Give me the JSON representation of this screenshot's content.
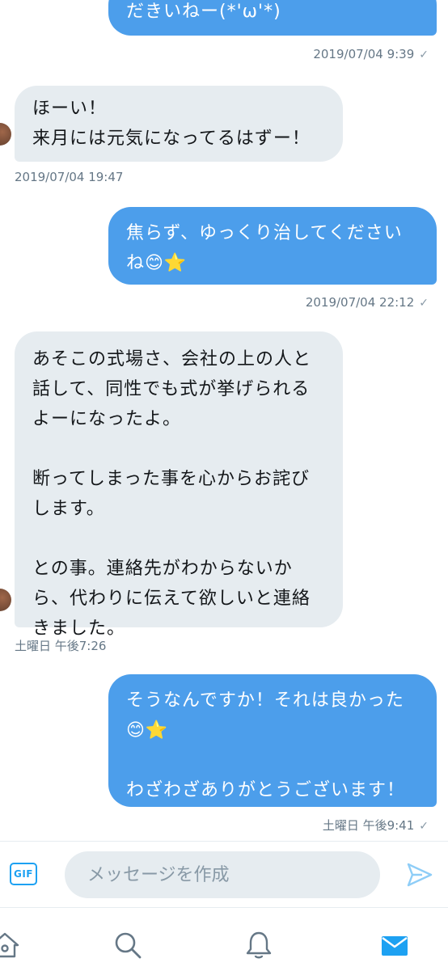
{
  "messages": [
    {
      "direction": "out",
      "text": "だきいねー(*'ω'*)",
      "timestamp": "2019/07/04 9:39",
      "read_mark": "✓"
    },
    {
      "direction": "in",
      "text": "ほーい！\n来月には元気になってるはずー！",
      "timestamp": "2019/07/04 19:47"
    },
    {
      "direction": "out",
      "text": "焦らず、ゆっくり治してくださいね😊⭐",
      "timestamp": "2019/07/04 22:12",
      "read_mark": "✓"
    },
    {
      "direction": "in",
      "text": "あそこの式場さ、会社の上の人と話して、同性でも式が挙げられるよーになったよ。\n\n断ってしまった事を心からお詫びします。\n\nとの事。連絡先がわからないから、代わりに伝えて欲しいと連絡きました。",
      "timestamp": "土曜日 午後7:26"
    },
    {
      "direction": "out",
      "text": "そうなんですか！それは良かった😊⭐\n\nわざわざありがとうございます！",
      "timestamp": "土曜日 午後9:41",
      "read_mark": "✓"
    }
  ],
  "compose": {
    "gif_label": "GIF",
    "placeholder": "メッセージを作成",
    "send_icon": "send-icon"
  },
  "tabbar": {
    "icons": [
      "home-icon",
      "search-icon",
      "notifications-icon",
      "messages-icon"
    ],
    "active": "messages-icon"
  },
  "colors": {
    "outgoing_bubble": "#4c9eeb",
    "incoming_bubble": "#e6ecf0",
    "accent": "#1da1f2",
    "timestamp": "#657786"
  }
}
